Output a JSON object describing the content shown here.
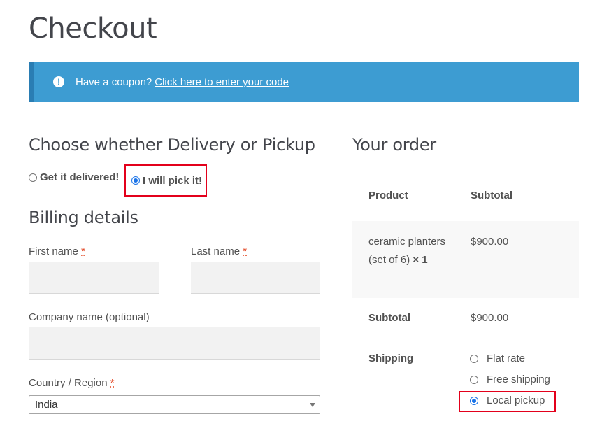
{
  "page": {
    "title": "Checkout"
  },
  "coupon": {
    "icon": "exclamation-icon",
    "text": "Have a coupon?",
    "link": "Click here to enter your code",
    "color": "#3d9cd2"
  },
  "delivery": {
    "heading": "Choose whether Delivery or Pickup",
    "options": [
      {
        "label": "Get it delivered!",
        "checked": false
      },
      {
        "label": "I will pick it!",
        "checked": true
      }
    ]
  },
  "billing": {
    "heading": "Billing details",
    "first_name": {
      "label": "First name",
      "required": "*",
      "value": ""
    },
    "last_name": {
      "label": "Last name",
      "required": "*",
      "value": ""
    },
    "company": {
      "label": "Company name (optional)",
      "value": ""
    },
    "country": {
      "label": "Country / Region",
      "required": "*",
      "value": "India"
    }
  },
  "order": {
    "heading": "Your order",
    "col_product": "Product",
    "col_subtotal": "Subtotal",
    "item": {
      "name": "ceramic planters (set of 6)",
      "qty": "× 1",
      "price": "$900.00"
    },
    "subtotal_label": "Subtotal",
    "subtotal_value": "$900.00",
    "shipping_label": "Shipping",
    "shipping_options": [
      {
        "label": "Flat rate",
        "checked": false
      },
      {
        "label": "Free shipping",
        "checked": false
      },
      {
        "label": "Local pickup",
        "checked": true
      }
    ]
  },
  "highlight_color": "#e3001b"
}
